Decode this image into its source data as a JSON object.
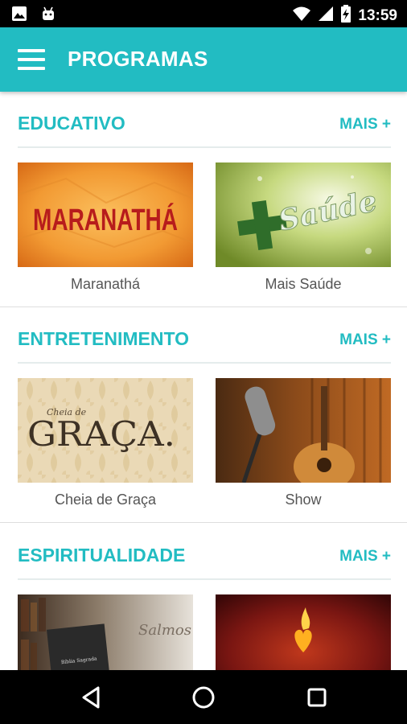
{
  "status_bar": {
    "time": "13:59",
    "left_icons": [
      "image-icon",
      "android-icon"
    ],
    "right_icons": [
      "wifi-icon",
      "signal-icon",
      "battery-icon"
    ]
  },
  "app_bar": {
    "title": "PROGRAMAS",
    "menu_icon": "hamburger-menu-icon",
    "color": "#22bcc2"
  },
  "sections": [
    {
      "title": "EDUCATIVO",
      "more_label": "MAIS +",
      "items": [
        {
          "label": "Maranathá",
          "thumb_text": "MARANATHÁ"
        },
        {
          "label": "Mais Saúde",
          "thumb_text": "Saúde"
        }
      ]
    },
    {
      "title": "ENTRETENIMENTO",
      "more_label": "MAIS +",
      "items": [
        {
          "label": "Cheia de Graça",
          "thumb_text_small": "Cheia de",
          "thumb_text": "GRAÇA."
        },
        {
          "label": "Show"
        }
      ]
    },
    {
      "title": "ESPIRITUALIDADE",
      "more_label": "MAIS +",
      "items": [
        {
          "thumb_text": "Salmos",
          "thumb_book_text": "Bíblia Sagrada"
        },
        {}
      ]
    }
  ],
  "nav_bar": {
    "icons": [
      "back-icon",
      "home-icon",
      "recents-icon"
    ]
  }
}
